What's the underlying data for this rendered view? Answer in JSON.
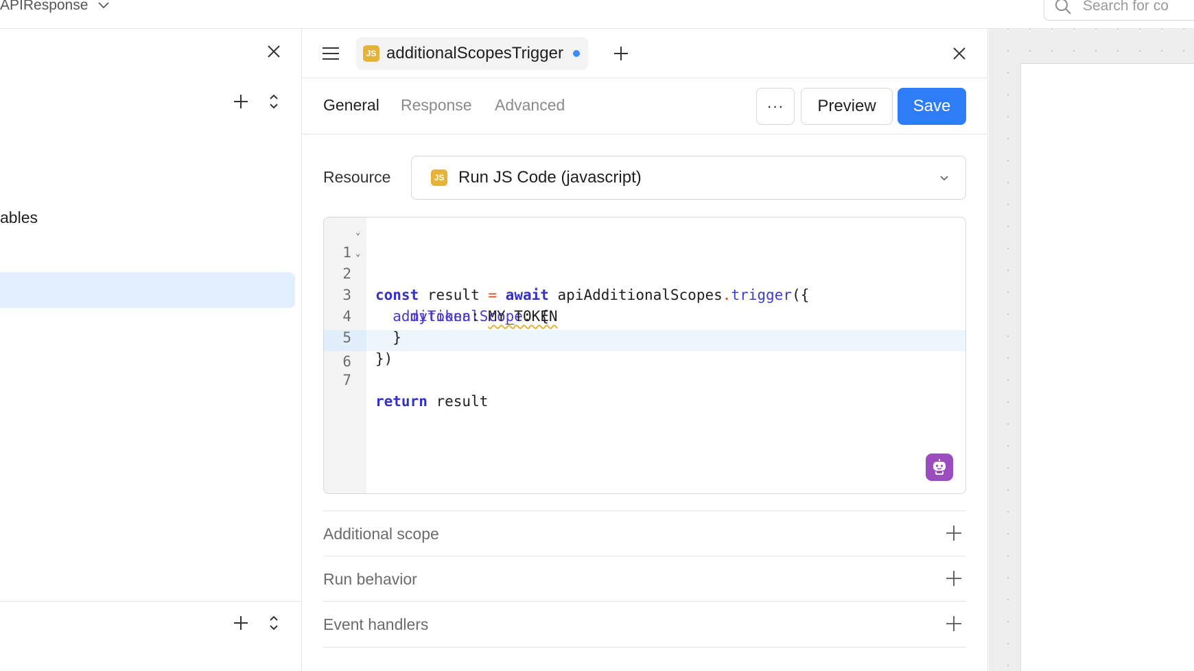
{
  "topbar": {
    "app_title": "APIResponse",
    "search_placeholder": "Search for co"
  },
  "sidebar": {
    "partial_label": "ables"
  },
  "panel": {
    "tab": {
      "badge": "JS",
      "name": "additionalScopesTrigger"
    },
    "subtabs": [
      "General",
      "Response",
      "Advanced"
    ],
    "more_label": "···",
    "preview_label": "Preview",
    "save_label": "Save",
    "resource": {
      "label": "Resource",
      "badge": "JS",
      "value": "Run JS Code (javascript)"
    },
    "editor": {
      "line_numbers": [
        "1",
        "2",
        "3",
        "4",
        "5",
        "6",
        "7"
      ],
      "tokens": {
        "const": "const",
        "result": " result ",
        "eq": "=",
        "await": " await",
        "api": " apiAdditionalScopes",
        "dot": ".",
        "trigger": "trigger",
        "open": "({",
        "additionalScope": "  additionalScope",
        "colon_brace": ": {",
        "myToken": "    myToken",
        "colon": ": ",
        "my_token_value": "MY_TOKEN",
        "close_inner": "  }",
        "close_outer": "})",
        "return": "return",
        "return_rest": " result"
      }
    },
    "sections": [
      "Additional scope",
      "Run behavior",
      "Event handlers"
    ]
  },
  "colors": {
    "accent": "#2f7df6",
    "js_badge": "#e5b23a",
    "ai_button": "#9b4dbf",
    "selected_row": "#e1efff"
  },
  "icons": [
    "chevron-down-icon",
    "search-icon",
    "close-icon",
    "plus-icon",
    "expand-collapse-icon",
    "hamburger-menu-icon",
    "ai-assistant-icon"
  ]
}
